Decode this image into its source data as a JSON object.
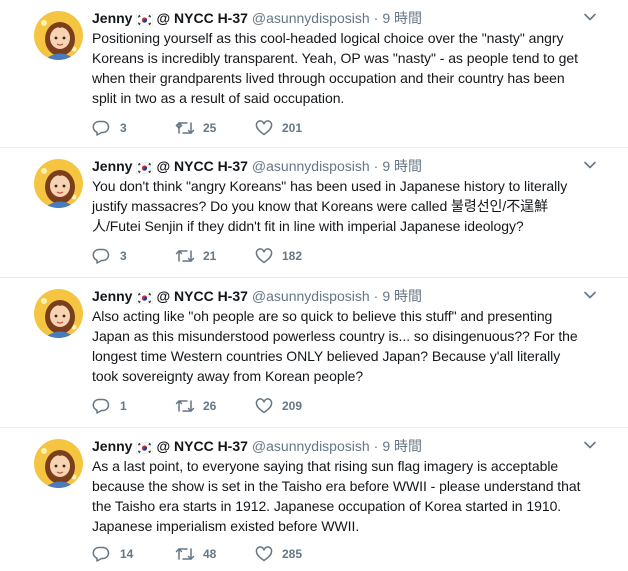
{
  "tweets": [
    {
      "name": "Jenny",
      "name_suffix": "@ NYCC H-37",
      "handle": "@asunnydisposish",
      "time": "9 時間",
      "lines": [
        "Positioning yourself as this cool-headed logical choice over the \"nasty\" angry",
        "Koreans is incredibly transparent. Yeah, OP was \"nasty\" - as people tend to get",
        "when  their grandparents lived through occupation and their country has been",
        "split in two as a result of said occupation."
      ],
      "replies": "3",
      "retweets": "25",
      "likes": "201"
    },
    {
      "name": "Jenny",
      "name_suffix": "@ NYCC H-37",
      "handle": "@asunnydisposish",
      "time": "9 時間",
      "lines": [
        "You don't think \"angry Koreans\" has been used in Japanese history to literally",
        "justify massacres? Do you know that Koreans were called 불령선인/不逞鮮",
        "人/Futei Senjin if they didn't fit in line with imperial Japanese ideology?"
      ],
      "replies": "3",
      "retweets": "21",
      "likes": "182"
    },
    {
      "name": "Jenny",
      "name_suffix": "@ NYCC H-37",
      "handle": "@asunnydisposish",
      "time": "9 時間",
      "lines": [
        "Also acting like \"oh people are so quick to believe this stuff\" and presenting",
        "Japan as this misunderstood powerless country is... so disingenuous?? For the",
        "longest time Western countries ONLY believed Japan? Because y'all literally",
        "took sovereignty away from Korean people?"
      ],
      "replies": "1",
      "retweets": "26",
      "likes": "209"
    },
    {
      "name": "Jenny",
      "name_suffix": "@ NYCC H-37",
      "handle": "@asunnydisposish",
      "time": "9 時間",
      "lines": [
        "As a last point, to everyone saying that rising sun flag imagery is acceptable",
        "because the show is set in the Taisho era before WWII - please understand that",
        "the Taisho era starts in 1912. Japanese occupation of Korea started in 1910.",
        "Japanese imperialism existed before WWII."
      ],
      "replies": "14",
      "retweets": "48",
      "likes": "285"
    }
  ],
  "icons": {
    "reply": "reply-icon",
    "retweet": "retweet-icon",
    "like": "heart-icon",
    "more": "chevron-down-icon",
    "flag": "korea-flag-icon"
  },
  "colors": {
    "text": "#14171a",
    "secondary": "#657786",
    "divider": "#e6ecf0",
    "avatar_bg": "#f5c542"
  }
}
